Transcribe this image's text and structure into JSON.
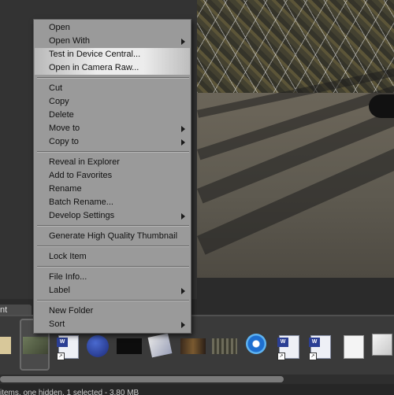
{
  "context_menu": {
    "items": [
      {
        "label": "Open"
      },
      {
        "label": "Open With"
      },
      {
        "label": "Test in Device Central..."
      },
      {
        "label": "Open in Camera Raw..."
      },
      {
        "label": "Cut"
      },
      {
        "label": "Copy"
      },
      {
        "label": "Delete"
      },
      {
        "label": "Move to"
      },
      {
        "label": "Copy to"
      },
      {
        "label": "Reveal in Explorer"
      },
      {
        "label": "Add to Favorites"
      },
      {
        "label": "Rename"
      },
      {
        "label": "Batch Rename..."
      },
      {
        "label": "Develop Settings"
      },
      {
        "label": "Generate High Quality Thumbnail"
      },
      {
        "label": "Lock Item"
      },
      {
        "label": "File Info..."
      },
      {
        "label": "Label"
      },
      {
        "label": "New Folder"
      },
      {
        "label": "Sort"
      }
    ]
  },
  "content_panel": {
    "tab_label": "nt",
    "file_icons": [
      "image-thumbnail",
      "image-thumbnail",
      "word-doc-icon",
      "eclipse-icon",
      "image-thumbnail",
      "document-set-icon",
      "image-thumbnail",
      "image-thumbnail",
      "internet-explorer-icon",
      "word-doc-icon",
      "word-doc-icon",
      "text-doc-icon",
      "notepad-icon"
    ]
  },
  "status_bar": {
    "text": "items, one hidden, 1 selected - 3.80 MB"
  },
  "colors": {
    "menu_bg": "#9a9a9a",
    "menu_highlight": "#ececec",
    "panel_bg": "#333333"
  }
}
